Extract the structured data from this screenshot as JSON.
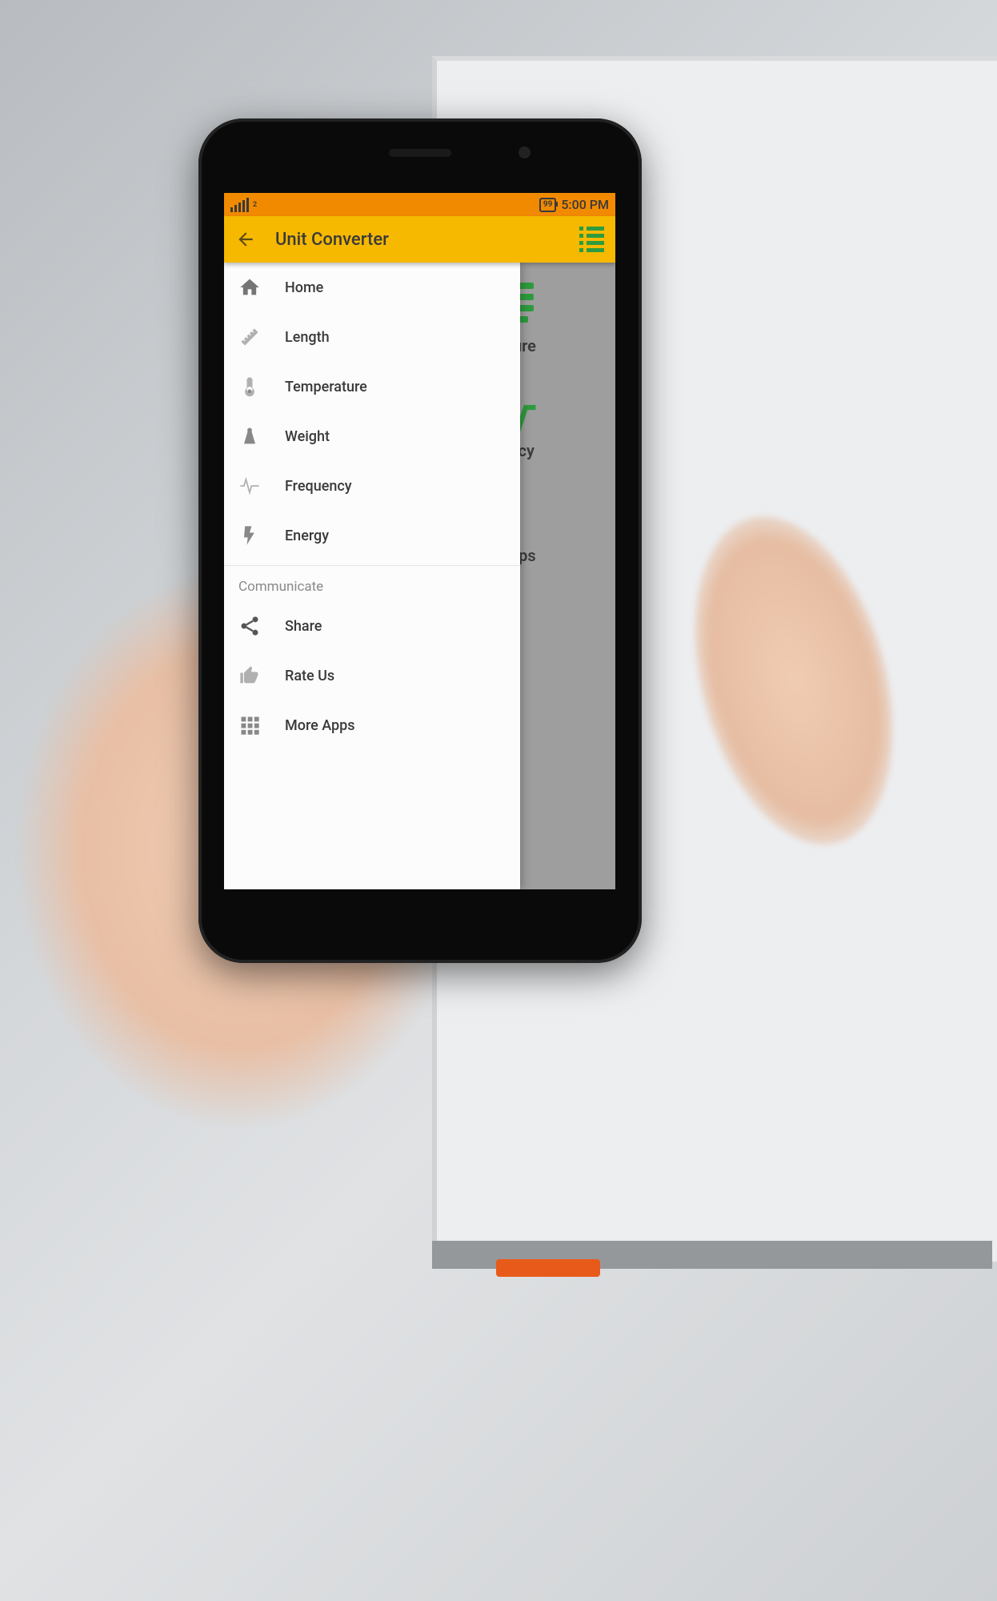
{
  "statusbar": {
    "signal_sub": "2",
    "battery": "99",
    "time": "5:00 PM"
  },
  "appbar": {
    "title": "Unit Converter"
  },
  "drawer": {
    "items": [
      {
        "label": "Home"
      },
      {
        "label": "Length"
      },
      {
        "label": "Temperature"
      },
      {
        "label": "Weight"
      },
      {
        "label": "Frequency"
      },
      {
        "label": "Energy"
      }
    ],
    "section": "Communicate",
    "comm": [
      {
        "label": "Share"
      },
      {
        "label": "Rate Us"
      },
      {
        "label": "More Apps"
      }
    ]
  },
  "main": {
    "cats": [
      {
        "label": "ature"
      },
      {
        "label": "ency"
      },
      {
        "label": "Apps"
      }
    ]
  }
}
